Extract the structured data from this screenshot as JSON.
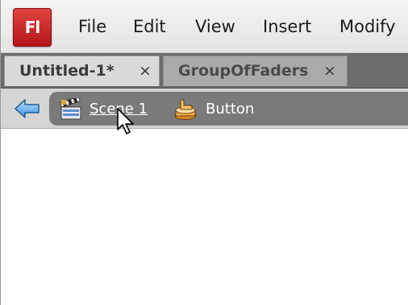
{
  "app": {
    "logo_text": "Fl",
    "brand_color": "#c8232b"
  },
  "menu": {
    "items": [
      "File",
      "Edit",
      "View",
      "Insert",
      "Modify"
    ]
  },
  "tabs": [
    {
      "label": "Untitled-1*",
      "close": "×",
      "active": true
    },
    {
      "label": "GroupOfFaders",
      "close": "×",
      "active": false
    }
  ],
  "editbar": {
    "back_icon": "back-arrow-icon",
    "breadcrumbs": [
      {
        "label": "Scene 1",
        "icon": "scene-clapperboard-icon",
        "link": true
      },
      {
        "label": "Button",
        "icon": "button-symbol-icon",
        "link": false
      }
    ]
  },
  "cursor": {
    "icon": "mouse-pointer-icon"
  }
}
